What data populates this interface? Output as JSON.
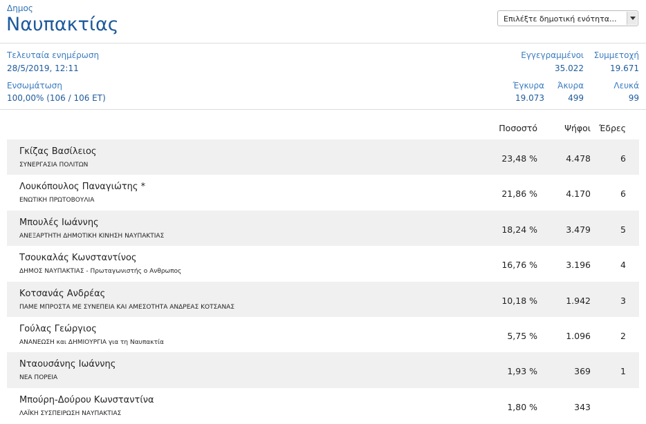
{
  "header": {
    "municipality_type": "Δημος",
    "municipality_name": "Ναυπακτίας",
    "unit_select": {
      "selected": "Επιλέξτε δημοτική ενότητα..."
    }
  },
  "stats": {
    "last_update_label": "Τελευταία ενημέρωση",
    "last_update_value": "28/5/2019, 12:11",
    "integration_label": "Ενσωμάτωση",
    "integration_value": "100,00% (106 / 106 ΕΤ)",
    "registered_label": "Εγγεγραμμένοι",
    "registered_value": "35.022",
    "turnout_label": "Συμμετοχή",
    "turnout_value": "19.671",
    "valid_label": "Έγκυρα",
    "valid_value": "19.073",
    "invalid_label": "Άκυρα",
    "invalid_value": "499",
    "blank_label": "Λευκά",
    "blank_value": "99"
  },
  "table": {
    "col_percent": "Ποσοστό",
    "col_votes": "Ψήφοι",
    "col_seats": "Έδρες",
    "rows": [
      {
        "name": "Γκίζας Βασίλειος",
        "party": "ΣΥΝΕΡΓΑΣΙΑ ΠΟΛΙΤΩΝ",
        "percent": "23,48 %",
        "votes": "4.478",
        "seats": "6"
      },
      {
        "name": "Λουκόπουλος Παναγιώτης *",
        "party": "ΕΝΩΤΙΚΗ ΠΡΩΤΟΒΟΥΛΙΑ",
        "percent": "21,86 %",
        "votes": "4.170",
        "seats": "6"
      },
      {
        "name": "Μπουλές Ιωάννης",
        "party": "ΑΝΕΞΑΡΤΗΤΗ ΔΗΜΟΤΙΚΗ ΚΙΝΗΣΗ ΝΑΥΠΑΚΤΙΑΣ",
        "percent": "18,24 %",
        "votes": "3.479",
        "seats": "5"
      },
      {
        "name": "Τσουκαλάς Κωνσταντίνος",
        "party": "ΔΗΜΟΣ ΝΑΥΠΑΚΤΙΑΣ - Πρωταγωνιστής ο Ανθρωπος",
        "percent": "16,76 %",
        "votes": "3.196",
        "seats": "4"
      },
      {
        "name": "Κοτσανάς Ανδρέας",
        "party": "ΠΑΜΕ ΜΠΡΟΣΤΑ ΜΕ ΣΥΝΕΠΕΙΑ ΚΑΙ ΑΜΕΣΟΤΗΤΑ ΑΝΔΡΕΑΣ ΚΟΤΣΑΝΑΣ",
        "percent": "10,18 %",
        "votes": "1.942",
        "seats": "3"
      },
      {
        "name": "Γούλας Γεώργιος",
        "party": "ΑΝΑΝΕΩΣΗ και ΔΗΜΙΟΥΡΓΙΑ για τη Ναυπακτία",
        "percent": "5,75 %",
        "votes": "1.096",
        "seats": "2"
      },
      {
        "name": "Νταουσάνης Ιωάννης",
        "party": "ΝΕΑ ΠΟΡΕΙΑ",
        "percent": "1,93 %",
        "votes": "369",
        "seats": "1"
      },
      {
        "name": "Μπούρη-Δούρου Κωνσταντίνα",
        "party": "ΛΑΪΚΗ ΣΥΣΠΕΙΡΩΣΗ ΝΑΥΠΑΚΤΙΑΣ",
        "percent": "1,80 %",
        "votes": "343",
        "seats": ""
      }
    ]
  }
}
